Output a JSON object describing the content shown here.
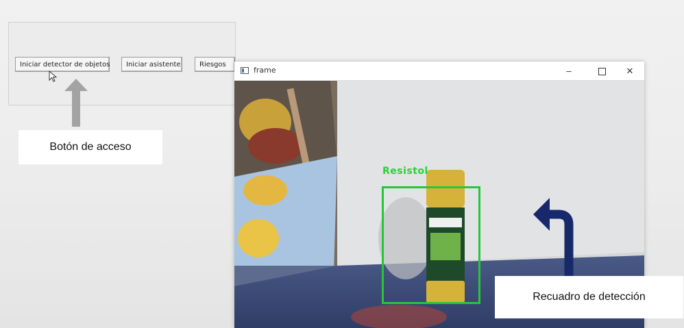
{
  "control_panel": {
    "buttons": [
      {
        "label": "Iniciar detector de objetos"
      },
      {
        "label": "Iniciar asistente"
      },
      {
        "label": "Riesgos"
      }
    ]
  },
  "frame_window": {
    "title": "frame",
    "controls": {
      "minimize": "–",
      "maximize": "□",
      "close": "✕"
    }
  },
  "detection": {
    "label": "Resistol",
    "box_color": "#27c63a"
  },
  "annotations": {
    "access_button": "Botón de acceso",
    "detection_box": "Recuadro de detección",
    "access_arrow_color": "#a3a3a3",
    "detection_arrow_color": "#17296a"
  }
}
